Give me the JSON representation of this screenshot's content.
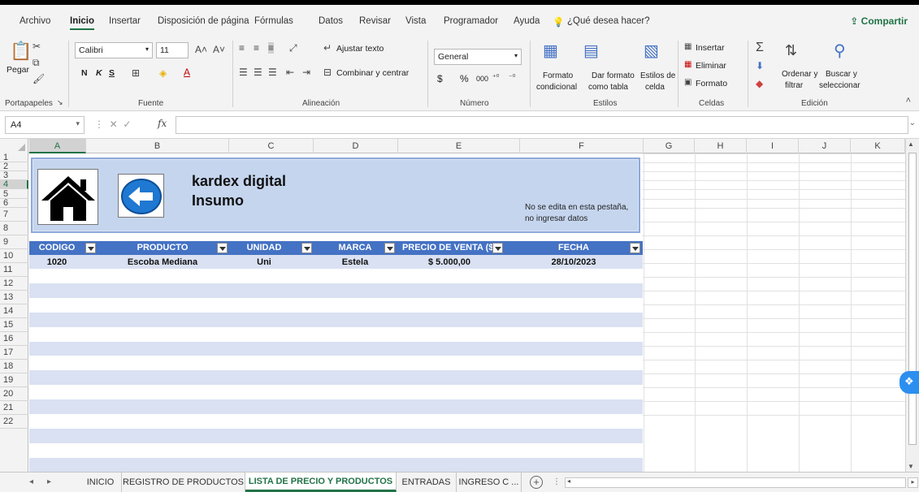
{
  "ribbon_tabs": [
    {
      "label": "Archivo"
    },
    {
      "label": "Inicio"
    },
    {
      "label": "Insertar"
    },
    {
      "label": "Disposición de página"
    },
    {
      "label": "Fórmulas"
    },
    {
      "label": "Datos"
    },
    {
      "label": "Revisar"
    },
    {
      "label": "Vista"
    },
    {
      "label": "Programador"
    },
    {
      "label": "Ayuda"
    }
  ],
  "search_hint": "¿Qué desea hacer?",
  "share_label": "Compartir",
  "clipboard": {
    "paste": "Pegar",
    "group": "Portapapeles"
  },
  "font": {
    "name": "Calibri",
    "size": "11",
    "group": "Fuente",
    "bold": "N",
    "italic": "K",
    "underline": "S"
  },
  "alignment": {
    "wrap": "Ajustar texto",
    "merge": "Combinar y centrar",
    "group": "Alineación"
  },
  "number": {
    "format": "General",
    "currency": "$",
    "percent": "%",
    "thousands": "000",
    "group": "Número"
  },
  "styles": {
    "conditional_1": "Formato",
    "conditional_2": "condicional",
    "table_1": "Dar formato",
    "table_2": "como tabla",
    "cell_1": "Estilos de",
    "cell_2": "celda",
    "group": "Estilos"
  },
  "cells_group": {
    "insert": "Insertar",
    "delete": "Eliminar",
    "format": "Formato",
    "group": "Celdas"
  },
  "editing": {
    "sort_1": "Ordenar y",
    "sort_2": "filtrar",
    "find_1": "Buscar y",
    "find_2": "seleccionar",
    "group": "Edición"
  },
  "name_box": "A4",
  "fx_label": "fx",
  "columns": [
    "A",
    "B",
    "C",
    "D",
    "E",
    "F",
    "G",
    "H",
    "I",
    "J",
    "K"
  ],
  "rows": [
    "1",
    "2",
    "3",
    "4",
    "5",
    "6",
    "7",
    "8",
    "9",
    "10",
    "11",
    "12",
    "13",
    "14",
    "15",
    "16",
    "17",
    "18",
    "19",
    "20",
    "21",
    "22"
  ],
  "banner": {
    "title_line1": "kardex digital",
    "title_line2": "Insumo",
    "note_line1": "No se edita en esta pestaña,",
    "note_line2": "no ingresar datos"
  },
  "table": {
    "headers": [
      "CODIGO",
      "PRODUCTO",
      "UNIDAD",
      "MARCA",
      "PRECIO DE VENTA ($)",
      "FECHA"
    ],
    "rows": [
      [
        "1020",
        "Escoba Mediana",
        "Uni",
        "Estela",
        "$ 5.000,00",
        "28/10/2023"
      ]
    ]
  },
  "sheet_tabs": [
    {
      "label": "INICIO"
    },
    {
      "label": "REGISTRO DE PRODUCTOS"
    },
    {
      "label": "LISTA DE PRECIO Y PRODUCTOS"
    },
    {
      "label": "ENTRADAS"
    },
    {
      "label": "INGRESO C ..."
    }
  ],
  "active_sheet_index": 2,
  "selected_cell": "A4",
  "colors": {
    "excel_green": "#217346",
    "table_header": "#4472c4",
    "band": "#d9e1f2",
    "banner": "#c5d5ee"
  }
}
